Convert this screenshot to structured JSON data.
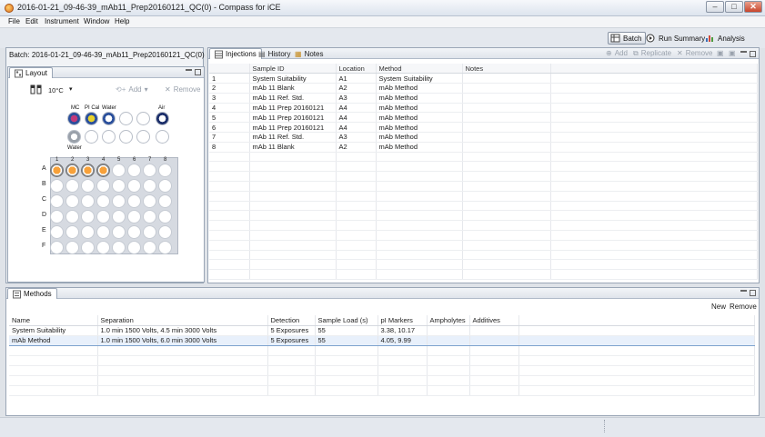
{
  "window": {
    "title": "2016-01-21_09-46-39_mAb11_Prep20160121_QC(0) - Compass for iCE",
    "minimize": "–",
    "maximize": "□",
    "close": "✕"
  },
  "menu": [
    "File",
    "Edit",
    "Instrument",
    "Window",
    "Help"
  ],
  "toolbar": {
    "batch": "Batch",
    "run_summary": "Run Summary",
    "analysis": "Analysis"
  },
  "batch": {
    "label": "Batch:  2016-01-21_09-46-39_mAb11_Prep20160121_QC(0)"
  },
  "layout": {
    "tab": "Layout",
    "temperature": "10°C",
    "add": "Add",
    "remove": "Remove",
    "reagent_labels": [
      "MC",
      "PI Cal",
      "Water",
      "Air"
    ],
    "water_label": "Water",
    "row_labels": [
      "A",
      "B",
      "C",
      "D",
      "E",
      "F"
    ],
    "col_labels": [
      "1",
      "2",
      "3",
      "4",
      "5",
      "6",
      "7",
      "8"
    ],
    "loaded_wells": [
      "A1",
      "A2",
      "A3",
      "A4"
    ],
    "well_colors": {
      "mc": "#c0397a",
      "pical": "#e8d22b",
      "water": "#2a4f9c",
      "air": "#1c2f6b",
      "sample": "#f7a13a"
    }
  },
  "injections": {
    "tabs": [
      "Injections",
      "History",
      "Notes"
    ],
    "actions": [
      "Add",
      "Replicate",
      "Remove"
    ],
    "columns": [
      "",
      "Sample ID",
      "Location",
      "Method",
      "Notes"
    ],
    "rows": [
      [
        "1",
        "System Suitability",
        "A1",
        "System Suitability",
        ""
      ],
      [
        "2",
        "mAb 11 Blank",
        "A2",
        "mAb Method",
        ""
      ],
      [
        "3",
        "mAb 11 Ref. Std.",
        "A3",
        "mAb Method",
        ""
      ],
      [
        "4",
        "mAb 11 Prep 20160121",
        "A4",
        "mAb Method",
        ""
      ],
      [
        "5",
        "mAb 11 Prep 20160121",
        "A4",
        "mAb Method",
        ""
      ],
      [
        "6",
        "mAb 11 Prep 20160121",
        "A4",
        "mAb Method",
        ""
      ],
      [
        "7",
        "mAb 11 Ref. Std.",
        "A3",
        "mAb Method",
        ""
      ],
      [
        "8",
        "mAb 11 Blank",
        "A2",
        "mAb Method",
        ""
      ]
    ]
  },
  "methods": {
    "tab": "Methods",
    "new": "New",
    "remove": "Remove",
    "columns": [
      "Name",
      "Separation",
      "Detection",
      "Sample Load (s)",
      "pI Markers",
      "Ampholytes",
      "Additives"
    ],
    "rows": [
      [
        "System Suitability",
        "1.0 min 1500 Volts, 4.5 min 3000 Volts",
        "5 Exposures",
        "55",
        "3.38, 10.17",
        "",
        ""
      ],
      [
        "mAb Method",
        "1.0 min 1500 Volts, 6.0 min 3000 Volts",
        "5 Exposures",
        "55",
        "4.05, 9.99",
        "",
        ""
      ]
    ]
  }
}
